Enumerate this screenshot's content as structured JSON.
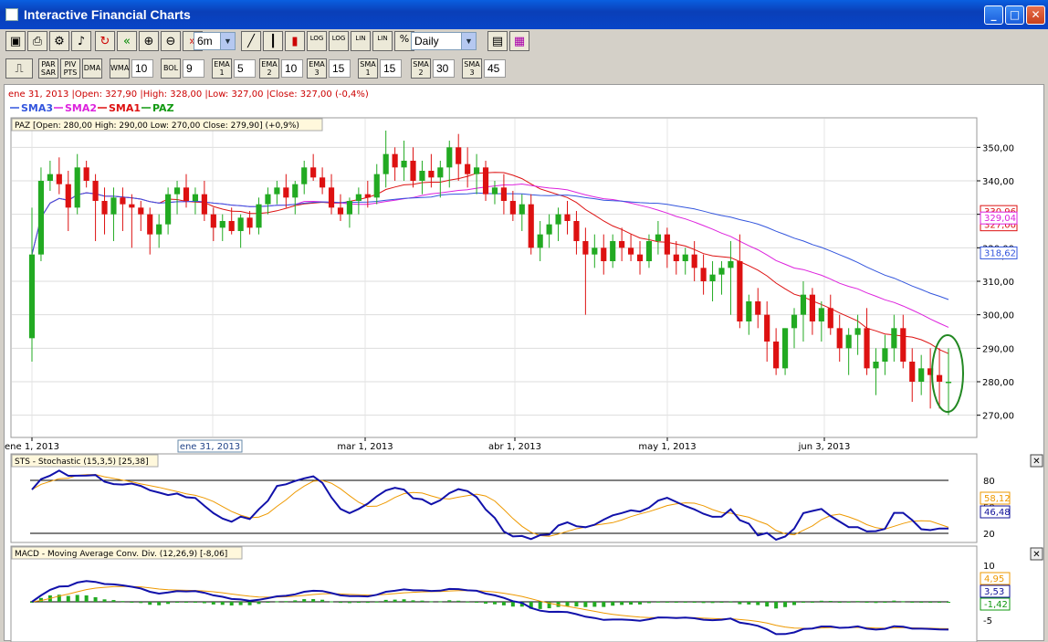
{
  "window": {
    "title": "Interactive Financial Charts"
  },
  "toolbar1": {
    "buttons": [
      "☐",
      "🖶",
      "⚙",
      "🔊",
      "↻",
      "«",
      "🔍",
      "🔍",
      "»"
    ],
    "range": "6m",
    "tools": [
      "LOG",
      "LOG",
      "LIN",
      "LIN",
      "%"
    ],
    "interval": "Daily"
  },
  "toolbar2": {
    "buttons": [
      {
        "label": "PAR\nSAR"
      },
      {
        "label": "PIV\nPTS"
      },
      {
        "label": "DMA"
      },
      {
        "label": "WMA",
        "value": "10"
      },
      {
        "label": "BOL",
        "value": "9"
      },
      {
        "label": "EMA\n1",
        "value": "5"
      },
      {
        "label": "EMA\n2",
        "value": "10"
      },
      {
        "label": "EMA\n3",
        "value": "15"
      },
      {
        "label": "SMA\n1",
        "value": "15"
      },
      {
        "label": "SMA\n2",
        "value": "30"
      },
      {
        "label": "SMA\n3",
        "value": "45"
      }
    ]
  },
  "info_line": "ene 31, 2013 |Open: 327,90 |High: 328,00 |Low: 327,00 |Close: 327,00 (-0,4%)",
  "legend": [
    {
      "name": "SMA3",
      "color": "#3355dd"
    },
    {
      "name": "SMA2",
      "color": "#dd22dd"
    },
    {
      "name": "SMA1",
      "color": "#dd1111"
    },
    {
      "name": "PAZ",
      "color": "#119911"
    }
  ],
  "price_header": "PAZ [Open: 280,00  High: 290,00  Low: 270,00  Close: 279,90] (+0,9%)",
  "stoch_header": "STS - Stochastic (15,3,5) [25,38]",
  "macd_header": "MACD - Moving Average Conv. Div. (12,26,9) [-8,06]",
  "x_labels": [
    "ene 1, 2013",
    "mar 1, 2013",
    "abr 1, 2013",
    "may 1, 2013",
    "jun 3, 2013"
  ],
  "cursor_date": "ene 31, 2013",
  "price_ticks": [
    "350,00",
    "340,00",
    "330,00",
    "320,00",
    "310,00",
    "300,00",
    "290,00",
    "280,00",
    "270,00"
  ],
  "price_tags": [
    {
      "text": "330,96",
      "color": "#dd1111"
    },
    {
      "text": "327,00",
      "color": "#dd1111"
    },
    {
      "text": "329,04",
      "color": "#dd22dd"
    },
    {
      "text": "317,72",
      "color": "#000000"
    },
    {
      "text": "318,62",
      "color": "#3355dd"
    }
  ],
  "stoch_ticks": [
    "80",
    "50",
    "20"
  ],
  "stoch_tags": [
    {
      "text": "58,12",
      "color": "#ee9900"
    },
    {
      "text": "46,48",
      "color": "#111199"
    }
  ],
  "macd_ticks": [
    "10",
    "5",
    "-5"
  ],
  "macd_tags": [
    {
      "text": "4,95",
      "color": "#ee9900"
    },
    {
      "text": "3,53",
      "color": "#111199"
    },
    {
      "text": "-1,42",
      "color": "#119911"
    }
  ],
  "chart_data": {
    "type": "candlestick",
    "ylim": [
      265,
      355
    ],
    "candles": [
      [
        293,
        332,
        286,
        318
      ],
      [
        318,
        344,
        316,
        340
      ],
      [
        340,
        346,
        337,
        342
      ],
      [
        342,
        347,
        336,
        339
      ],
      [
        339,
        343,
        325,
        332
      ],
      [
        332,
        348,
        330,
        344
      ],
      [
        344,
        346,
        338,
        340
      ],
      [
        340,
        342,
        322,
        334
      ],
      [
        334,
        338,
        324,
        330
      ],
      [
        330,
        338,
        322,
        335
      ],
      [
        335,
        338,
        325,
        333
      ],
      [
        333,
        336,
        320,
        332
      ],
      [
        332,
        334,
        325,
        330
      ],
      [
        330,
        332,
        318,
        324
      ],
      [
        324,
        330,
        320,
        327
      ],
      [
        327,
        338,
        324,
        336
      ],
      [
        336,
        340,
        330,
        338
      ],
      [
        338,
        342,
        332,
        334
      ],
      [
        334,
        338,
        330,
        336
      ],
      [
        336,
        340,
        328,
        330
      ],
      [
        330,
        332,
        322,
        326
      ],
      [
        326,
        330,
        322,
        328
      ],
      [
        328,
        332,
        324,
        325
      ],
      [
        325,
        330,
        320,
        329
      ],
      [
        329,
        331,
        324,
        326
      ],
      [
        326,
        335,
        324,
        333
      ],
      [
        333,
        338,
        330,
        336
      ],
      [
        336,
        340,
        333,
        338
      ],
      [
        338,
        342,
        332,
        335
      ],
      [
        335,
        340,
        330,
        339
      ],
      [
        339,
        346,
        336,
        344
      ],
      [
        344,
        348,
        340,
        341
      ],
      [
        341,
        344,
        336,
        338
      ],
      [
        338,
        342,
        330,
        332
      ],
      [
        332,
        336,
        328,
        330
      ],
      [
        330,
        335,
        326,
        334
      ],
      [
        334,
        338,
        330,
        336
      ],
      [
        336,
        340,
        332,
        335
      ],
      [
        335,
        345,
        333,
        342
      ],
      [
        342,
        355,
        338,
        348
      ],
      [
        348,
        350,
        340,
        344
      ],
      [
        344,
        352,
        340,
        346
      ],
      [
        346,
        350,
        338,
        340
      ],
      [
        340,
        346,
        336,
        343
      ],
      [
        343,
        348,
        338,
        341
      ],
      [
        341,
        346,
        335,
        344
      ],
      [
        344,
        352,
        338,
        350
      ],
      [
        350,
        354,
        340,
        345
      ],
      [
        345,
        350,
        338,
        342
      ],
      [
        342,
        348,
        336,
        344
      ],
      [
        344,
        346,
        334,
        336
      ],
      [
        336,
        340,
        333,
        338
      ],
      [
        338,
        342,
        330,
        334
      ],
      [
        334,
        337,
        328,
        330
      ],
      [
        330,
        336,
        325,
        333
      ],
      [
        333,
        336,
        318,
        320
      ],
      [
        320,
        328,
        316,
        324
      ],
      [
        324,
        330,
        320,
        327
      ],
      [
        327,
        332,
        322,
        330
      ],
      [
        330,
        334,
        324,
        328
      ],
      [
        328,
        331,
        318,
        322
      ],
      [
        322,
        326,
        300,
        318
      ],
      [
        318,
        324,
        314,
        320
      ],
      [
        320,
        324,
        312,
        316
      ],
      [
        316,
        324,
        314,
        322
      ],
      [
        322,
        326,
        316,
        320
      ],
      [
        320,
        324,
        316,
        318
      ],
      [
        318,
        322,
        312,
        316
      ],
      [
        316,
        324,
        314,
        322
      ],
      [
        322,
        328,
        318,
        324
      ],
      [
        324,
        326,
        314,
        318
      ],
      [
        318,
        322,
        312,
        316
      ],
      [
        316,
        320,
        312,
        318
      ],
      [
        318,
        322,
        310,
        314
      ],
      [
        314,
        318,
        306,
        310
      ],
      [
        310,
        316,
        304,
        312
      ],
      [
        312,
        316,
        306,
        314
      ],
      [
        314,
        322,
        300,
        316
      ],
      [
        316,
        324,
        296,
        298
      ],
      [
        298,
        306,
        294,
        304
      ],
      [
        304,
        308,
        296,
        300
      ],
      [
        300,
        304,
        286,
        292
      ],
      [
        292,
        296,
        282,
        284
      ],
      [
        284,
        296,
        282,
        296
      ],
      [
        296,
        302,
        290,
        300
      ],
      [
        300,
        310,
        292,
        306
      ],
      [
        306,
        308,
        294,
        298
      ],
      [
        298,
        304,
        292,
        302
      ],
      [
        302,
        306,
        294,
        296
      ],
      [
        296,
        300,
        286,
        290
      ],
      [
        290,
        296,
        282,
        294
      ],
      [
        294,
        300,
        288,
        296
      ],
      [
        296,
        302,
        282,
        284
      ],
      [
        284,
        290,
        276,
        286
      ],
      [
        286,
        294,
        282,
        290
      ],
      [
        290,
        300,
        286,
        296
      ],
      [
        296,
        300,
        284,
        286
      ],
      [
        286,
        290,
        274,
        280
      ],
      [
        280,
        288,
        276,
        284
      ],
      [
        284,
        290,
        272,
        282
      ],
      [
        282,
        290,
        272,
        280
      ],
      [
        280,
        290,
        270,
        280
      ]
    ]
  }
}
